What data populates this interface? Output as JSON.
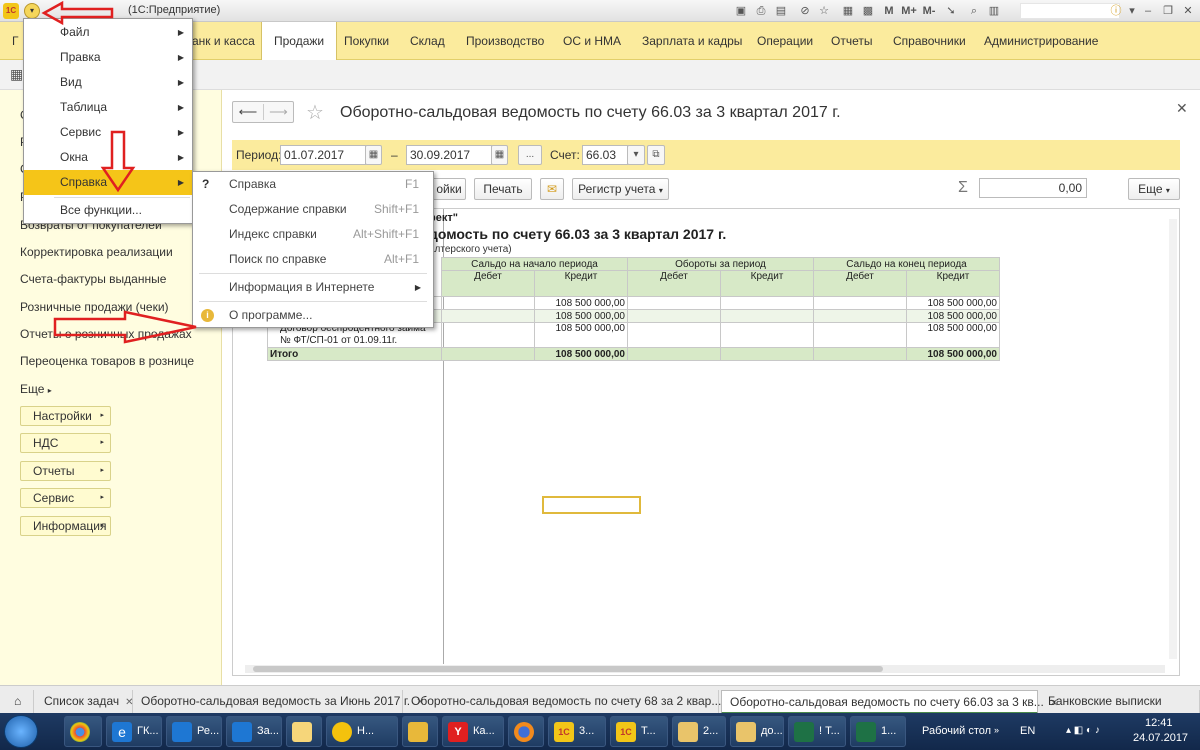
{
  "window": {
    "title": "(1С:Предприятие)",
    "toolbar_icons": [
      "save-icon",
      "print-icon",
      "preview-icon",
      "attach-icon",
      "bookmark-icon",
      "calendar-icon",
      "calc-icon",
      "memory-m-icon",
      "memory-mplus-icon",
      "memory-mminus-icon",
      "search-icon",
      "panels-icon",
      "info-icon",
      "minimize-icon",
      "restore-icon",
      "close-icon"
    ],
    "memory_labels": {
      "m": "M",
      "mplus": "M+",
      "mminus": "M-"
    }
  },
  "sections": [
    {
      "label": "Г"
    },
    {
      "label": "анк и касса"
    },
    {
      "label": "Продажи",
      "active": true
    },
    {
      "label": "Покупки"
    },
    {
      "label": "Склад"
    },
    {
      "label": "Производство"
    },
    {
      "label": "ОС и НМА"
    },
    {
      "label": "Зарплата и кадры"
    },
    {
      "label": "Операции"
    },
    {
      "label": "Отчеты"
    },
    {
      "label": "Справочники"
    },
    {
      "label": "Администрирование"
    }
  ],
  "leftnav": {
    "partial_letters": [
      "С",
      "Р",
      "С",
      "Р"
    ],
    "links": [
      "Возвраты от покупателей",
      "Корректировка реализации",
      "Счета-фактуры выданные",
      "Розничные продажи (чеки)",
      "Отчеты о розничных продажах",
      "Переоценка товаров в рознице",
      "Еще"
    ],
    "buttons": [
      "Настройки",
      "НДС",
      "Отчеты",
      "Сервис",
      "Информация"
    ]
  },
  "document": {
    "title": "Оборотно-сальдовая ведомость по счету 66.03 за 3 квартал 2017 г.",
    "period_label": "Период:",
    "period_from": "01.07.2017",
    "dash": "–",
    "period_to": "30.09.2017",
    "ellipsis_button": "...",
    "account_label": "Счет:",
    "account_value": "66.03",
    "buttons": {
      "settings_partial": "ойки",
      "print": "Печать",
      "register": "Регистр учета",
      "more": "Еще"
    },
    "sum_label": "Σ",
    "sum_value": "0,00"
  },
  "report": {
    "org_partial": "рект\"",
    "title_partial": "домость по счету 66.03 за 3 квартал 2017 г.",
    "subtitle_partial": "алтерского учета)",
    "headers": {
      "opening": "Сальдо на начало периода",
      "turnover": "Обороты за период",
      "closing": "Сальдо на конец периода",
      "debit": "Дебет",
      "credit": "Кредит"
    },
    "rows": [
      {
        "label": "",
        "open_credit": "108 500 000,00",
        "close_credit": "108 500 000,00"
      },
      {
        "label": "",
        "open_credit": "108 500 000,00",
        "close_credit": "108 500 000,00"
      },
      {
        "label": "Договор беспроцентного займа № ФТ/СП-01 от 01.09.11г.",
        "open_credit": "108 500 000,00",
        "close_credit": "108 500 000,00"
      }
    ],
    "total": {
      "label": "Итого",
      "open_credit": "108 500 000,00",
      "close_credit": "108 500 000,00"
    }
  },
  "main_menu": {
    "items": [
      {
        "label": "Файл",
        "has_sub": true
      },
      {
        "label": "Правка",
        "has_sub": true
      },
      {
        "label": "Вид",
        "has_sub": true
      },
      {
        "label": "Таблица",
        "has_sub": true
      },
      {
        "label": "Сервис",
        "has_sub": true
      },
      {
        "label": "Окна",
        "has_sub": true
      },
      {
        "label": "Справка",
        "has_sub": true,
        "highlighted": true
      }
    ],
    "all_functions": "Все функции..."
  },
  "help_submenu": {
    "items": [
      {
        "icon": "?",
        "label": "Справка",
        "key": "F1"
      },
      {
        "label": "Содержание справки",
        "key": "Shift+F1"
      },
      {
        "label": "Индекс справки",
        "key": "Alt+Shift+F1"
      },
      {
        "label": "Поиск по справке",
        "key": "Alt+F1"
      },
      {
        "label": "Информация в Интернете",
        "has_sub": true
      },
      {
        "label": "О программе...",
        "icon_name": "info-icon"
      }
    ]
  },
  "tabs": [
    {
      "label": "Список задач"
    },
    {
      "label": "Оборотно-сальдовая ведомость за Июнь 2017 г."
    },
    {
      "label": "Оборотно-сальдовая ведомость по счету 68 за 2 квар..."
    },
    {
      "label": "Оборотно-сальдовая ведомость по счету 66.03 за 3 кв...",
      "active": true
    },
    {
      "label": "Банковские выписки"
    }
  ],
  "taskbar": {
    "items": [
      "ГК...",
      "Ре...",
      "За...",
      "",
      "Н...",
      "",
      "Ка...",
      "",
      "3...",
      "Т...",
      "2...",
      "до...",
      "! Т...",
      "1..."
    ],
    "desktop_label": "Рабочий стол",
    "lang": "EN",
    "time": "12:41",
    "date": "24.07.2017"
  },
  "colors": {
    "sections_bg": "#fbeb9d",
    "menu_highlight": "#f5c518",
    "report_header": "#d7e9c7",
    "annotation_arrow": "#e02020"
  }
}
